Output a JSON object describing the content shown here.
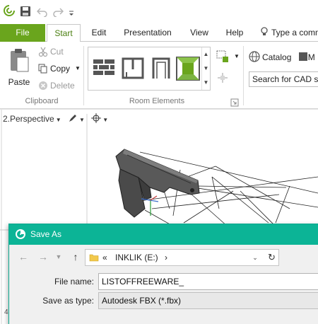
{
  "app": {
    "logo_icon": "app-logo-icon",
    "accent": "#6aa51d",
    "dialog_accent": "#0cb496"
  },
  "quick_access": {
    "items": [
      "save-icon",
      "undo-icon",
      "redo-icon",
      "customize-dropdown-icon"
    ]
  },
  "tabs": {
    "file": "File",
    "start": "Start",
    "edit": "Edit",
    "presentation": "Presentation",
    "view": "View",
    "help": "Help",
    "tell_me": "Type a comm"
  },
  "ribbon": {
    "clipboard": {
      "paste": "Paste",
      "cut": "Cut",
      "copy": "Copy",
      "delete": "Delete",
      "group_label": "Clipboard"
    },
    "room_elements": {
      "group_label": "Room Elements",
      "items": [
        "wall-icon",
        "room-plan-icon",
        "door-frame-icon",
        "floor-icon"
      ]
    },
    "catalog": {
      "label": "Catalog",
      "extra": "M",
      "search_placeholder": "Search for CAD sy"
    }
  },
  "viewport": {
    "title": "2.Perspective",
    "side_mark": "4"
  },
  "save_dialog": {
    "title": "Save As",
    "path_prefix": "«",
    "path_location": "INKLIK (E:)",
    "path_separator": "›",
    "file_name_label": "File name:",
    "file_name_value": "LISTOFFREEWARE_",
    "save_type_label": "Save as type:",
    "save_type_value": "Autodesk FBX (*.fbx)"
  }
}
